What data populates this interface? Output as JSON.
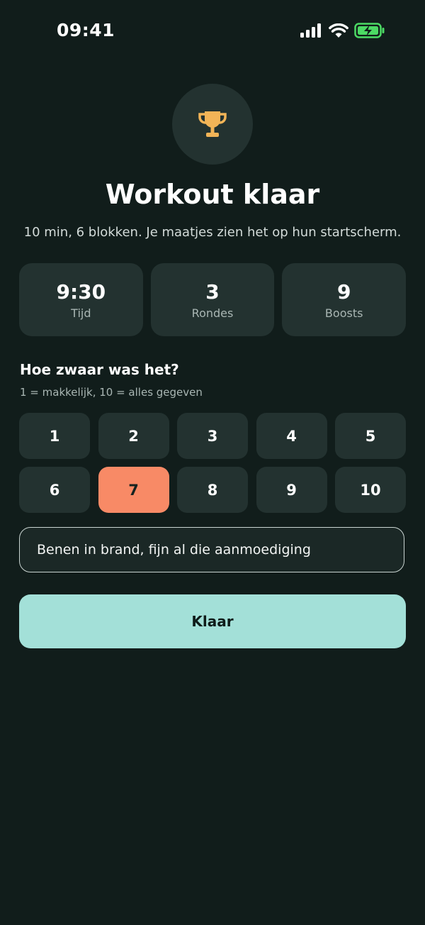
{
  "status_bar": {
    "time": "09:41"
  },
  "header": {
    "icon": "trophy-icon",
    "title": "Workout klaar",
    "subtitle": "10 min, 6 blokken. Je maatjes zien het op hun startscherm."
  },
  "stats": [
    {
      "value": "9:30",
      "label": "Tijd"
    },
    {
      "value": "3",
      "label": "Rondes"
    },
    {
      "value": "9",
      "label": "Boosts"
    }
  ],
  "rating": {
    "question": "Hoe zwaar was het?",
    "hint": "1 = makkelijk, 10 = alles gegeven",
    "options": [
      "1",
      "2",
      "3",
      "4",
      "5",
      "6",
      "7",
      "8",
      "9",
      "10"
    ],
    "selected": "7"
  },
  "note": {
    "value": "Benen in brand, fijn al die aanmoediging"
  },
  "done_button": {
    "label": "Klaar"
  },
  "colors": {
    "background": "#111d1b",
    "card": "#233230",
    "accent_selected": "#f88a66",
    "primary_button": "#a3e0d8",
    "trophy": "#f2b457",
    "battery": "#4cd964"
  }
}
